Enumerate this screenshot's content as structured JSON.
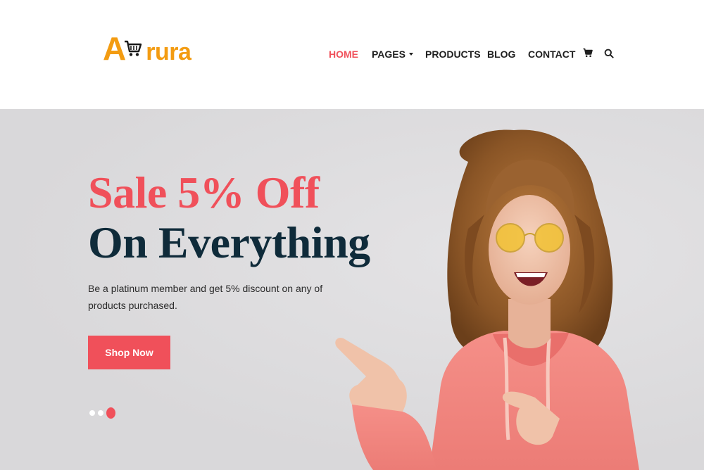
{
  "brand": {
    "logo_first_letter": "A",
    "logo_rest": "rura",
    "accent_color": "#f39c12"
  },
  "nav": {
    "items": [
      {
        "label": "HOME",
        "active": true
      },
      {
        "label": "PAGES",
        "has_dropdown": true
      },
      {
        "label": "PRODUCTS"
      },
      {
        "label": "BLOG"
      },
      {
        "label": "CONTACT"
      }
    ],
    "icons": [
      "cart-icon",
      "search-icon"
    ],
    "active_color": "#f0505a"
  },
  "hero": {
    "headline_line1": "Sale 5% Off",
    "headline_line2": "On Everything",
    "description": "Be a platinum member and get 5% discount on any of products purchased.",
    "cta_label": "Shop Now",
    "slider": {
      "total": 3,
      "active_index": 3
    },
    "colors": {
      "accent": "#f0505a",
      "headline_dark": "#0f2b3a",
      "background": "#dedddf"
    }
  }
}
